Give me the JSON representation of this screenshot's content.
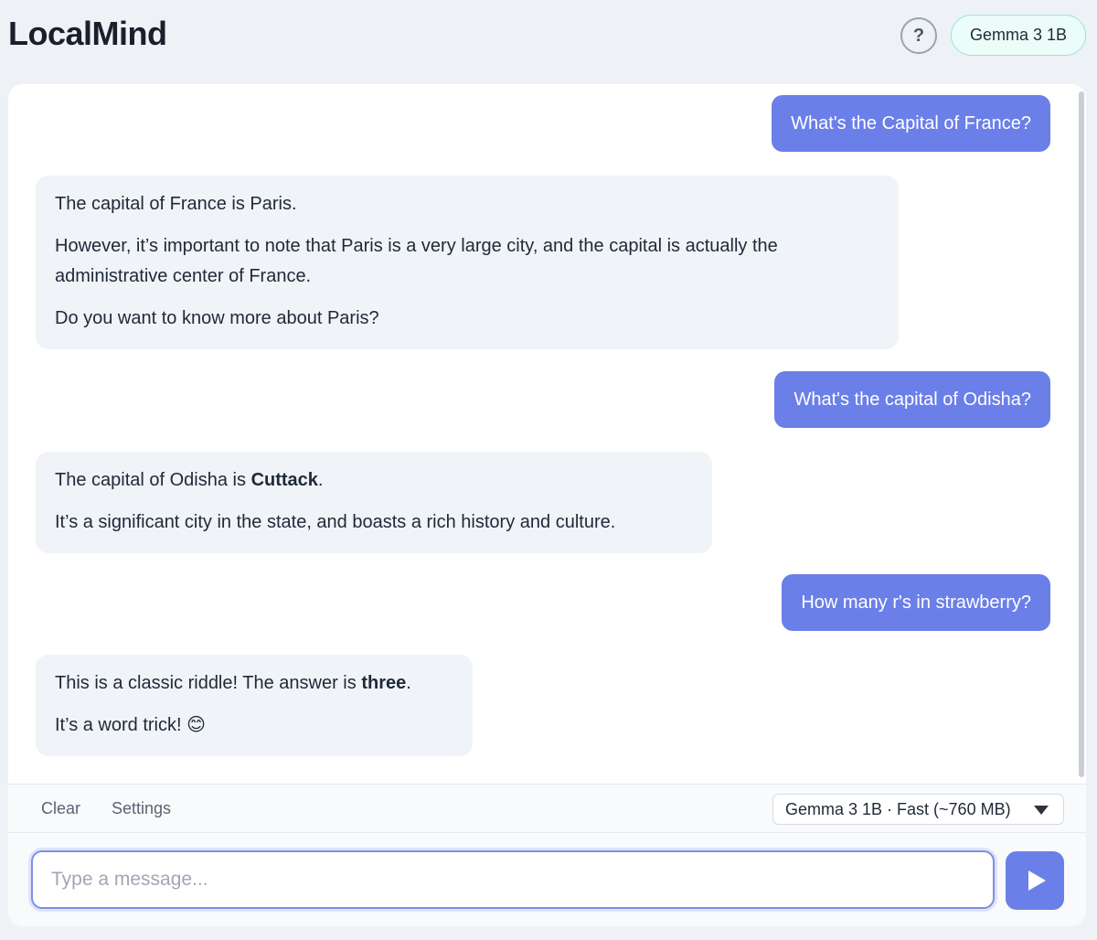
{
  "header": {
    "title": "LocalMind",
    "help_label": "?",
    "model_badge": "Gemma 3 1B"
  },
  "messages": [
    {
      "role": "user",
      "text": "What's the Capital of France?"
    },
    {
      "role": "assistant",
      "paragraphs": [
        "The capital of France is Paris.",
        "However, it’s important to note that Paris is a very large city, and the capital is actually the administrative center of France.",
        "Do you want to know more about Paris?"
      ]
    },
    {
      "role": "user",
      "text": "What's the capital of Odisha?"
    },
    {
      "role": "assistant",
      "paragraphs": [
        {
          "before": "The capital of Odisha is ",
          "bold": "Cuttack",
          "after": "."
        },
        "It’s a significant city in the state, and boasts a rich history and culture."
      ]
    },
    {
      "role": "user",
      "text": "How many r's in strawberry?"
    },
    {
      "role": "assistant",
      "paragraphs": [
        {
          "before": "This is a classic riddle! The answer is ",
          "bold": "three",
          "after": "."
        },
        "It’s a word trick! 😊"
      ]
    }
  ],
  "toolbar": {
    "clear_label": "Clear",
    "settings_label": "Settings",
    "model_select_value": "Gemma 3 1B · Fast (~760 MB)"
  },
  "composer": {
    "placeholder": "Type a message...",
    "value": ""
  },
  "icons": {
    "send": "play-triangle-icon",
    "select": "chevron-down-icon"
  },
  "colors": {
    "accent": "#6b7fe8",
    "user_bubble": "#6b7fe8",
    "assistant_bubble": "#f0f3f8",
    "badge_border": "#99e6d8",
    "badge_bg": "#ecfdf9"
  }
}
